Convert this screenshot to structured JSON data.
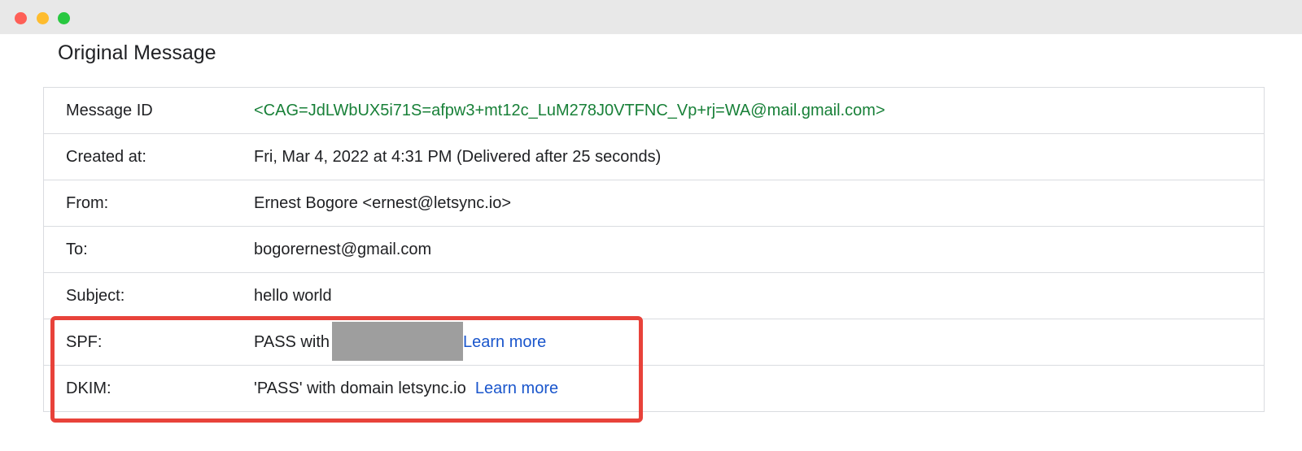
{
  "page": {
    "title": "Original Message"
  },
  "rows": [
    {
      "label": "Message ID",
      "value": "<CAG=JdLWbUX5i71S=afpw3+mt12c_LuM278J0VTFNC_Vp+rj=WA@mail.gmail.com>"
    },
    {
      "label": "Created at:",
      "value": "Fri, Mar 4, 2022 at 4:31 PM (Delivered after 25 seconds)"
    },
    {
      "label": "From:",
      "value": "Ernest Bogore <ernest@letsync.io>"
    },
    {
      "label": "To:",
      "value": "bogorernest@gmail.com"
    },
    {
      "label": "Subject:",
      "value": "hello world"
    },
    {
      "label": "SPF:",
      "value": "PASS with",
      "link": "Learn more"
    },
    {
      "label": "DKIM:",
      "value": "'PASS' with domain letsync.io",
      "link": "Learn more"
    }
  ],
  "colors": {
    "message_id": "#188038",
    "link": "#1a56cc",
    "highlight": "#e8423a",
    "redaction": "#9e9e9e"
  }
}
